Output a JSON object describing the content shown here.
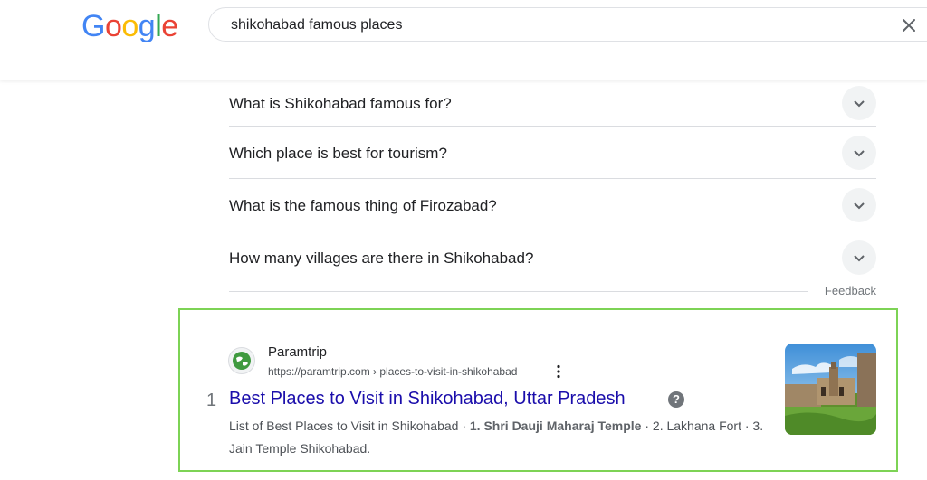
{
  "header": {
    "logo_letters": [
      "G",
      "o",
      "o",
      "g",
      "l",
      "e"
    ],
    "logo_colors": [
      "#4285F4",
      "#EA4335",
      "#FBBC05",
      "#4285F4",
      "#34A853",
      "#EA4335"
    ],
    "search_value": "shikohabad famous places",
    "clear_icon": "close-icon"
  },
  "people_also_ask": [
    {
      "question": "What is Shikohabad famous for?"
    },
    {
      "question": "Which place is best for tourism?"
    },
    {
      "question": "What is the famous thing of Firozabad?"
    },
    {
      "question": "How many villages are there in Shikohabad?"
    }
  ],
  "feedback_label": "Feedback",
  "result": {
    "site_name": "Paramtrip",
    "url": "https://paramtrip.com › places-to-visit-in-shikohabad",
    "rank": "1",
    "title": "Best Places to Visit in Shikohabad, Uttar Pradesh",
    "help_glyph": "?",
    "snippet_1": "List of Best Places to Visit in Shikohabad · ",
    "snippet_bold": "1. Shri Dauji Maharaj Temple",
    "snippet_2": " · 2. Lakhana Fort · 3. Jain Temple Shikohabad.",
    "highlight_color": "#7dd355",
    "title_color": "#1a0dab"
  }
}
